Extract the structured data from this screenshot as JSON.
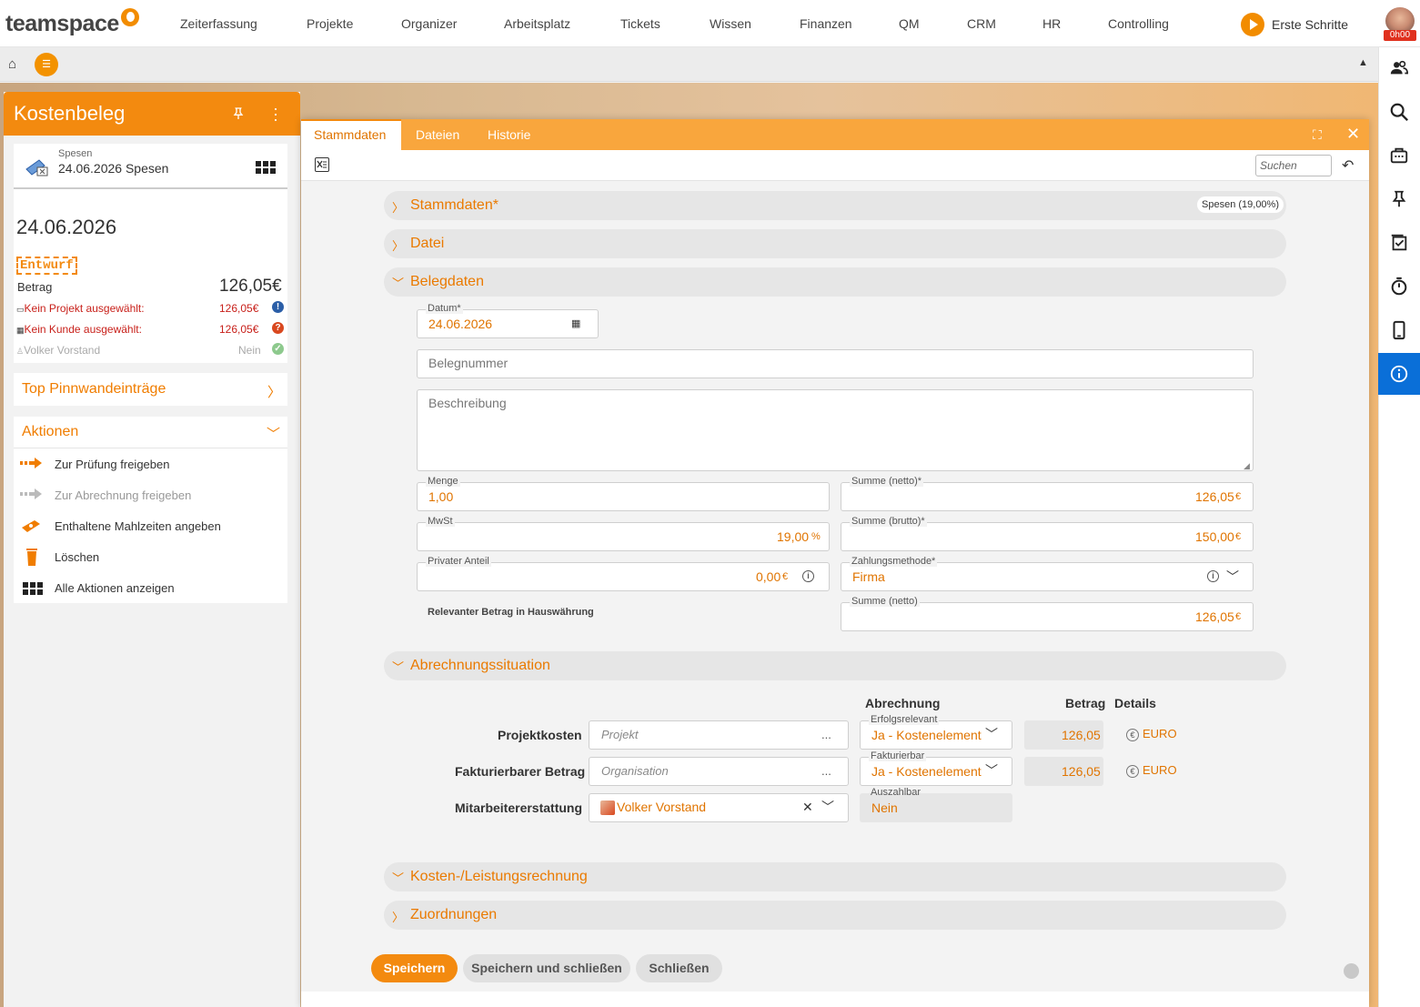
{
  "topnav": {
    "logo": "teamspace",
    "items": [
      "Zeiterfassung",
      "Projekte",
      "Organizer",
      "Arbeitsplatz",
      "Tickets",
      "Wissen",
      "Finanzen",
      "QM",
      "CRM",
      "HR",
      "Controlling"
    ],
    "erste_schritte": "Erste Schritte",
    "avatar_time": "0h00"
  },
  "left_panel": {
    "title": "Kostenbeleg",
    "card": {
      "subtitle": "Spesen",
      "title": "24.06.2026 Spesen"
    },
    "date": "24.06.2026",
    "status_badge": "Entwurf",
    "betrag_label": "Betrag",
    "betrag_value": "126,05€",
    "rows": [
      {
        "label": "Kein Projekt ausgewählt:",
        "value": "126,05€",
        "icon": "exclamation-icon",
        "color": "#2b5ea7"
      },
      {
        "label": "Kein Kunde ausgewählt:",
        "value": "126,05€",
        "icon": "question-icon",
        "color": "#d9481f"
      },
      {
        "label": "Volker Vorstand",
        "value": "Nein",
        "icon": "check-icon",
        "color": "#8dc98d"
      }
    ],
    "pinnwand_title": "Top Pinnwandeinträge",
    "aktionen_title": "Aktionen",
    "actions": [
      "Zur Prüfung freigeben",
      "Zur Abrechnung freigeben",
      "Enthaltene Mahlzeiten angeben",
      "Löschen",
      "Alle Aktionen anzeigen"
    ]
  },
  "dialog": {
    "tabs": [
      "Stammdaten",
      "Dateien",
      "Historie"
    ],
    "search_placeholder": "Suchen",
    "sections": {
      "stammdaten": "Stammdaten*",
      "stammdaten_badge": "Spesen (19,00%)",
      "datei": "Datei",
      "belegdaten": "Belegdaten",
      "abrechnung": "Abrechnungssituation",
      "kosten": "Kosten-/Leistungsrechnung",
      "zuordnungen": "Zuordnungen"
    },
    "belegdaten": {
      "datum_label": "Datum*",
      "datum_value": "24.06.2026",
      "belegnummer_placeholder": "Belegnummer",
      "beschreibung_placeholder": "Beschreibung",
      "menge_label": "Menge",
      "menge_value": "1,00",
      "summe_netto_label": "Summe (netto)*",
      "summe_netto_value": "126,05",
      "mwst_label": "MwSt",
      "mwst_value": "19,00",
      "mwst_unit": "%",
      "summe_brutto_label": "Summe (brutto)*",
      "summe_brutto_value": "150,00",
      "privat_label": "Privater Anteil",
      "privat_value": "0,00",
      "zahlung_label": "Zahlungsmethode*",
      "zahlung_value": "Firma",
      "relevant_label": "Relevanter Betrag in Hauswährung",
      "summe_netto2_label": "Summe (netto)",
      "summe_netto2_value": "126,05",
      "currency": "€"
    },
    "abrechnung": {
      "col_abrechnung": "Abrechnung",
      "col_betrag": "Betrag",
      "col_details": "Details",
      "rows": [
        {
          "label": "Projektkosten",
          "input_placeholder": "Projekt",
          "select_label": "Erfolgsrelevant",
          "select_value": "Ja - Kostenelement",
          "betrag": "126,05",
          "details": "EURO"
        },
        {
          "label": "Fakturierbarer Betrag",
          "input_placeholder": "Organisation",
          "select_label": "Fakturierbar",
          "select_value": "Ja - Kostenelement",
          "betrag": "126,05",
          "details": "EURO"
        },
        {
          "label": "Mitarbeitererstattung",
          "input_value": "Volker Vorstand",
          "select_label": "Auszahlbar",
          "select_value": "Nein"
        }
      ]
    },
    "buttons": {
      "save": "Speichern",
      "save_close": "Speichern und schließen",
      "close": "Schließen"
    }
  },
  "colors": {
    "brand": "#f38a0f",
    "tabbar": "#f9a63d",
    "accent_text": "#e07400",
    "error": "#c8201a",
    "info": "#0a6fd8"
  }
}
